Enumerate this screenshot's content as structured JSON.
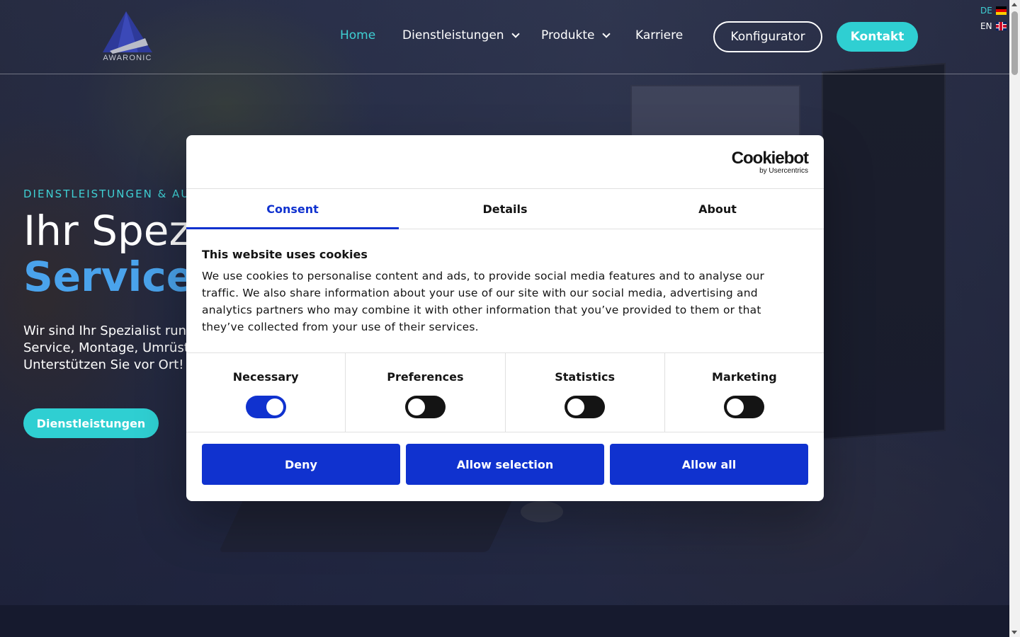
{
  "header": {
    "logo_text": "AWARONIC",
    "nav": [
      {
        "label": "Home",
        "active": true
      },
      {
        "label": "Dienstleistungen",
        "has_dropdown": true
      },
      {
        "label": "Produkte",
        "has_dropdown": true
      },
      {
        "label": "Karriere"
      }
    ],
    "configurator_label": "Konfigurator",
    "contact_label": "Kontakt",
    "languages": [
      {
        "code": "DE",
        "flag": "flag-de-icon",
        "active": true
      },
      {
        "code": "EN",
        "flag": "flag-uk-icon",
        "active": false
      }
    ]
  },
  "hero": {
    "eyebrow": "DIENSTLEISTUNGEN & AUT",
    "headline_line1": "Ihr Spez",
    "headline_line2": "Service",
    "lead_lines": [
      "Wir sind Ihr Spezialist rund",
      "Service, Montage, Umrüst",
      "Unterstützen Sie vor Ort!"
    ],
    "cta_label": "Dienstleistungen"
  },
  "cookie_dialog": {
    "brand": "Cookiebot",
    "brand_sub": "by Usercentrics",
    "tabs": [
      {
        "label": "Consent",
        "active": true
      },
      {
        "label": "Details",
        "active": false
      },
      {
        "label": "About",
        "active": false
      }
    ],
    "title": "This website uses cookies",
    "body": "We use cookies to personalise content and ads, to provide social media features and to analyse our traffic. We also share information about your use of our site with our social media, advertising and analytics partners who may combine it with other information that you’ve provided to them or that they’ve collected from your use of their services.",
    "categories": [
      {
        "label": "Necessary",
        "enabled": true
      },
      {
        "label": "Preferences",
        "enabled": false
      },
      {
        "label": "Statistics",
        "enabled": false
      },
      {
        "label": "Marketing",
        "enabled": false
      }
    ],
    "buttons": {
      "deny": "Deny",
      "allow_selection": "Allow selection",
      "allow_all": "Allow all"
    }
  },
  "colors": {
    "accent_teal": "#2fcfd2",
    "hero_blue": "#4aa3ec",
    "cookiebot_blue": "#1032cf"
  }
}
